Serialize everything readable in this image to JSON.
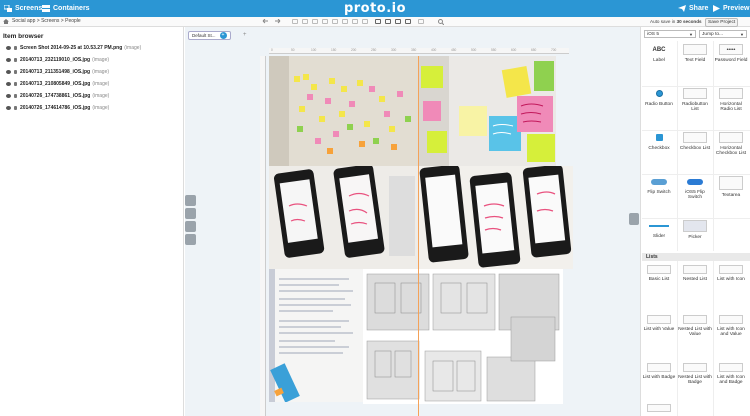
{
  "topbar": {
    "screens_label": "Screens",
    "containers_label": "Containers",
    "logo": "proto.io",
    "share_label": "Share",
    "preview_label": "Preview"
  },
  "subbar": {
    "breadcrumb": [
      "Social app",
      "Screens",
      "People"
    ],
    "autosave_prefix": "Auto save in",
    "autosave_value": "30 seconds",
    "save_project_label": "Save Project"
  },
  "item_browser": {
    "title": "Item browser",
    "items": [
      {
        "name": "Screen Shot 2014-09-25 at 10.53.27 PM.png",
        "type": "(image)"
      },
      {
        "name": "20140713_232119010_iOS.jpg",
        "type": "(image)"
      },
      {
        "name": "20140713_211351498_iOS.jpg",
        "type": "(image)"
      },
      {
        "name": "20140713_210805849_iOS.jpg",
        "type": "(image)"
      },
      {
        "name": "20140726_174738861_iOS.jpg",
        "type": "(image)"
      },
      {
        "name": "20140726_174614786_iOS.jpg",
        "type": "(image)"
      }
    ]
  },
  "canvas": {
    "tab_label": "Default St...",
    "tab_count": "+",
    "add_tab": "+",
    "ruler_top": [
      "0",
      "50",
      "100",
      "150",
      "200",
      "250",
      "300",
      "350",
      "400",
      "450",
      "500",
      "550",
      "600",
      "650",
      "700"
    ]
  },
  "right_panel": {
    "device_select": "iOS 5",
    "jump_select": "Jump to...",
    "components": [
      {
        "label": "Label",
        "thumb": "ABC"
      },
      {
        "label": "Text Field",
        "thumb": ""
      },
      {
        "label": "Password Field",
        "thumb": "•••••"
      },
      {
        "label": "Radio Button",
        "thumb": ""
      },
      {
        "label": "Radiobutton List",
        "thumb": ""
      },
      {
        "label": "Horizontal Radio List",
        "thumb": ""
      },
      {
        "label": "Checkbox",
        "thumb": ""
      },
      {
        "label": "Checkbox List",
        "thumb": ""
      },
      {
        "label": "Horizontal Checkbox List",
        "thumb": ""
      },
      {
        "label": "Flip Switch",
        "thumb": ""
      },
      {
        "label": "iOS5 Flip Switch",
        "thumb": ""
      },
      {
        "label": "Textarea",
        "thumb": ""
      },
      {
        "label": "Slider",
        "thumb": ""
      },
      {
        "label": "Picker",
        "thumb": ""
      }
    ],
    "lists_header": "Lists",
    "lists": [
      {
        "label": "Basic List"
      },
      {
        "label": "Nested List"
      },
      {
        "label": "List with Icon"
      },
      {
        "label": "List with Value"
      },
      {
        "label": "Nested List with Value"
      },
      {
        "label": "List with Icon and Value"
      },
      {
        "label": "List with Badge"
      },
      {
        "label": "Nested List with Badge"
      },
      {
        "label": "List with Icon and Badge"
      }
    ]
  },
  "colors": {
    "topbar": "#2b96d4",
    "accent": "#2b96d4"
  }
}
